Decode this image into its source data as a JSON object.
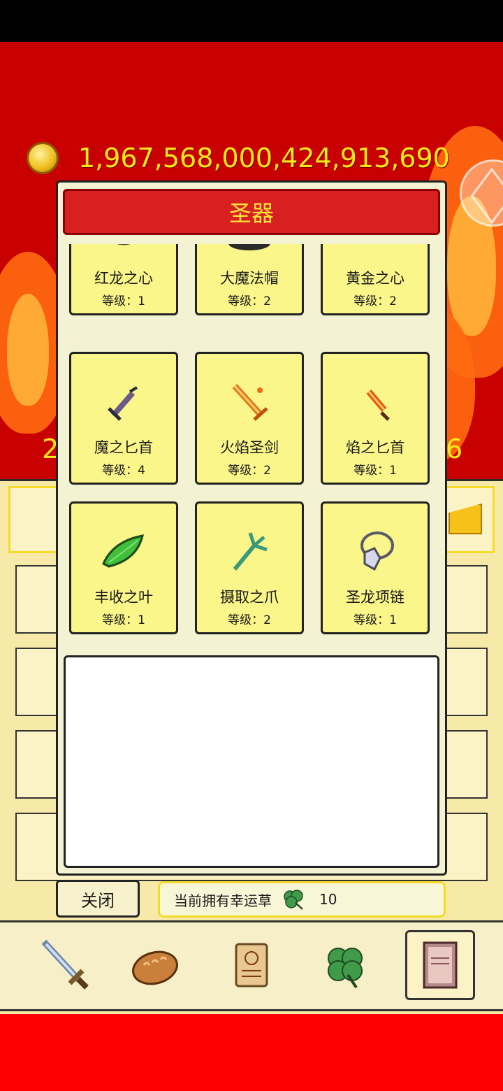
{
  "currency": {
    "coins": "1,967,568,000,424,913,690",
    "icon": "gold-coin-icon"
  },
  "background": {
    "left_partial": "2",
    "right_partial": "6"
  },
  "modal": {
    "title": "圣器",
    "items": [
      {
        "name": "红龙之心",
        "level": "等级：1",
        "icon": "red-dragon-heart-amulet-icon"
      },
      {
        "name": "大魔法帽",
        "level": "等级：2",
        "icon": "wizard-hat-icon"
      },
      {
        "name": "黄金之心",
        "level": "等级：2",
        "icon": "golden-heart-icon"
      },
      {
        "name": "魔之匕首",
        "level": "等级：4",
        "icon": "demon-dagger-icon"
      },
      {
        "name": "火焰圣剑",
        "level": "等级：2",
        "icon": "flame-sword-icon"
      },
      {
        "name": "焰之匕首",
        "level": "等级：1",
        "icon": "flame-dagger-icon"
      },
      {
        "name": "丰收之叶",
        "level": "等级：1",
        "icon": "harvest-leaf-icon"
      },
      {
        "name": "摄取之爪",
        "level": "等级：2",
        "icon": "grab-claw-icon"
      },
      {
        "name": "圣龙项链",
        "level": "等级：1",
        "icon": "dragon-necklace-icon"
      }
    ]
  },
  "footer": {
    "close_label": "关闭",
    "clover_label": "当前拥有幸运草",
    "clover_count": "10"
  },
  "nav": [
    {
      "icon": "sword-icon",
      "active": false
    },
    {
      "icon": "bread-icon",
      "active": false
    },
    {
      "icon": "scroll-icon",
      "active": false
    },
    {
      "icon": "clover-icon",
      "active": false
    },
    {
      "icon": "book-icon",
      "active": true
    }
  ],
  "colors": {
    "header_red": "#d92020",
    "title_yellow": "#ffe53b",
    "card_yellow": "#fbf68a",
    "coin_text": "#ffe81a"
  }
}
